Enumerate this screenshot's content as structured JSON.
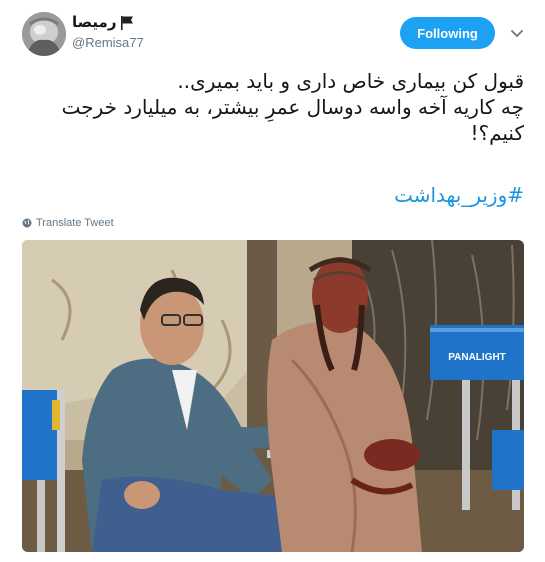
{
  "tweet": {
    "author": {
      "display_name": "رمیصا",
      "handle": "@Remisa77",
      "flag_icon": "black-flag-icon",
      "avatar_icon": "avatar-photo"
    },
    "follow_button": {
      "label": "Following",
      "color": "#1da1f2"
    },
    "menu_icon": "chevron-down-icon",
    "text_lines": [
      "قبول کن بیماری خاص داری و باید بمیری..",
      "چه کاریه آخه واسه دوسال عمرِ بیشتر، به میلیارد خرجت",
      "کنیم؟!"
    ],
    "hashtag": "#وزیر_بهداشت",
    "hashtag_color": "#1b95e0",
    "translate_label": "Translate Tweet",
    "translate_icon": "globe-icon",
    "photo": {
      "chair_label": "PANALIGHT"
    }
  }
}
